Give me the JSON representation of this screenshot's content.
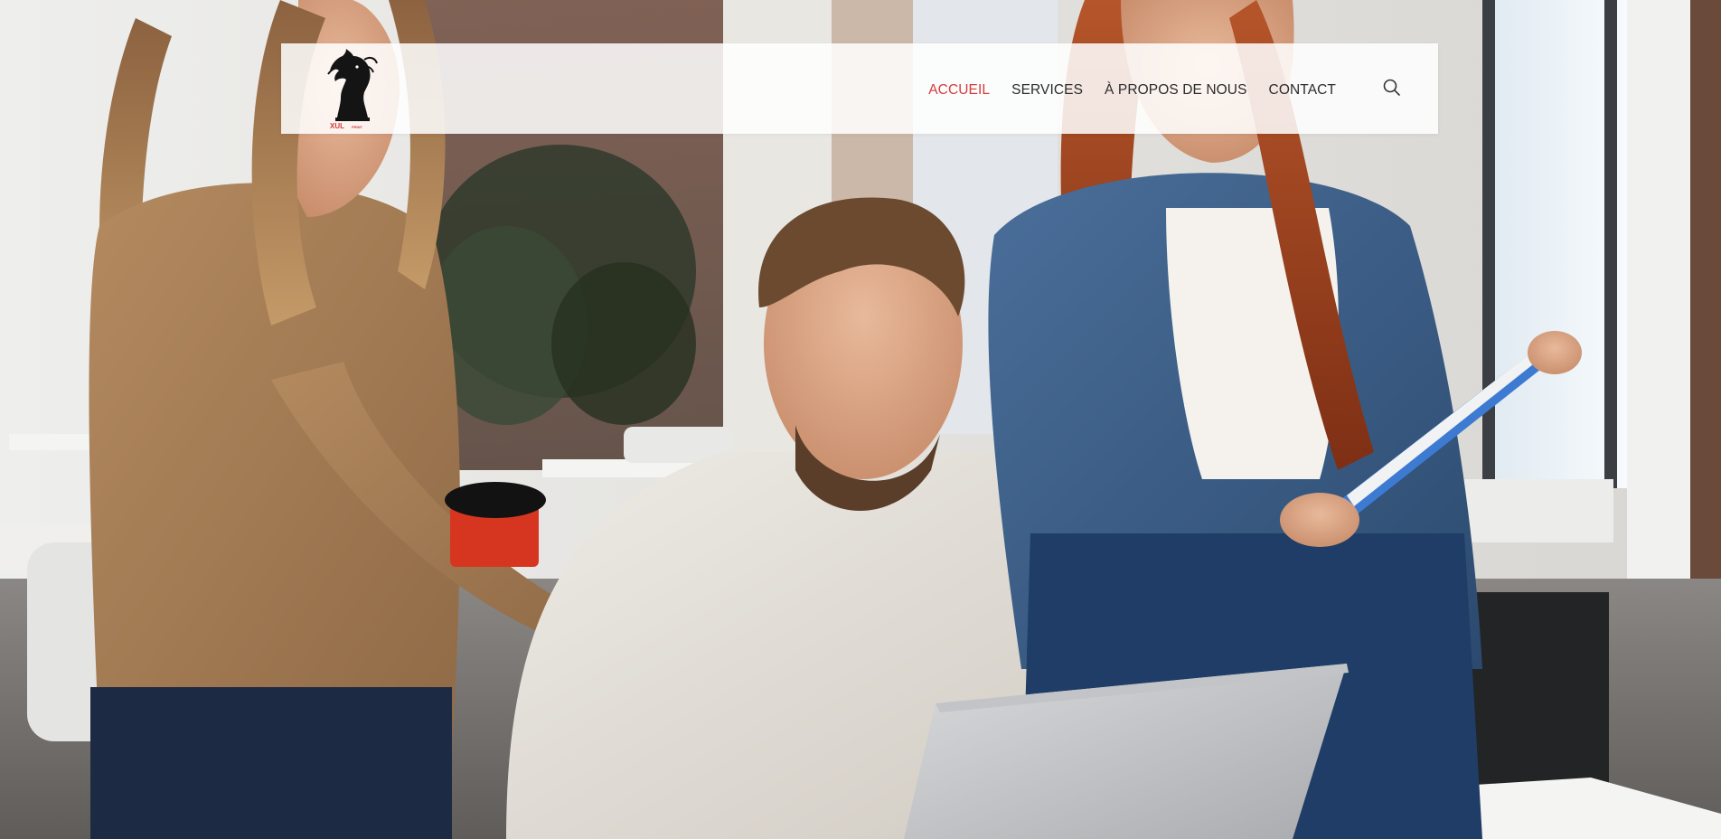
{
  "site": {
    "logo": {
      "text": "XUL",
      "small_text": "PRINT",
      "icon": "dragon-chess-knight-icon"
    }
  },
  "nav": {
    "items": [
      {
        "label": "ACCUEIL",
        "active": true
      },
      {
        "label": "SERVICES",
        "active": false
      },
      {
        "label": "À PROPOS DE NOUS",
        "active": false
      },
      {
        "label": "CONTACT",
        "active": false
      }
    ],
    "search_icon": "search-icon"
  },
  "hero": {
    "image": "office-team-photo"
  },
  "colors": {
    "accent": "#d63b3b",
    "nav_text": "#2b2b2b",
    "header_bg": "#ffffff"
  }
}
